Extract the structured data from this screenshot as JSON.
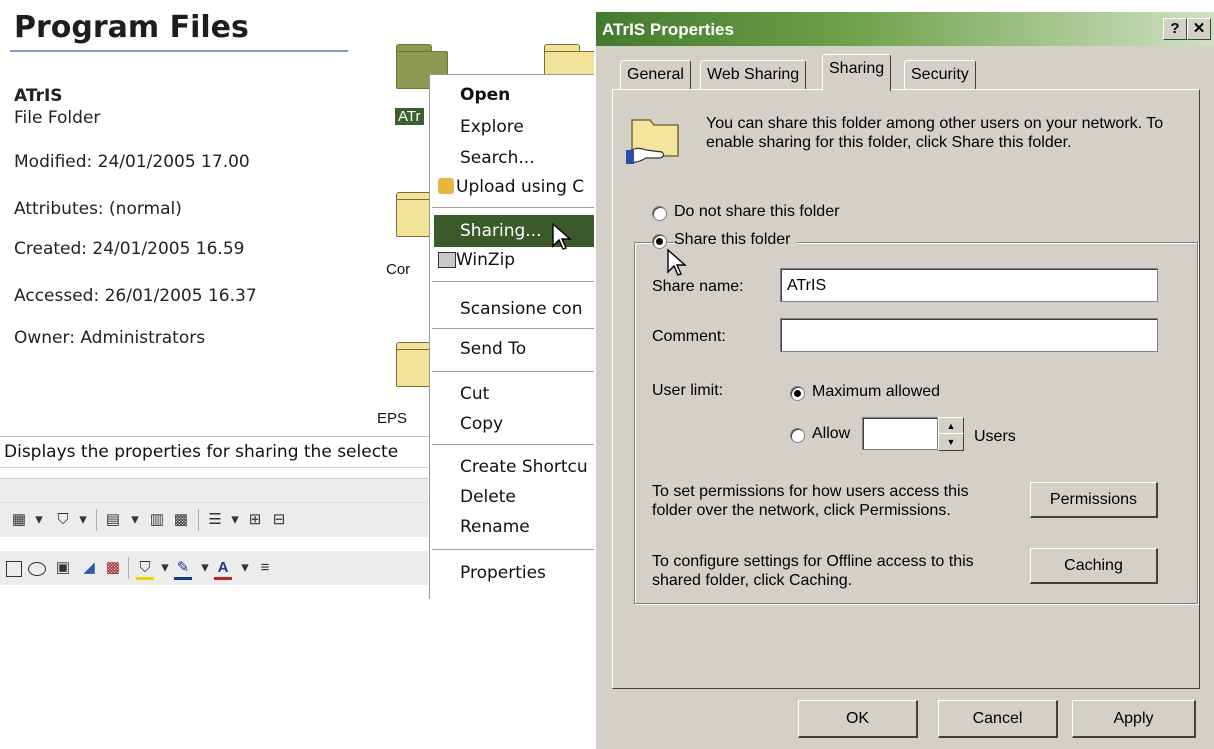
{
  "explorer": {
    "title": "Program Files",
    "selected_name": "ATrIS",
    "selected_type": "File Folder",
    "modified": "Modified: 24/01/2005 17.00",
    "attributes": "Attributes: (normal)",
    "created": "Created: 24/01/2005 16.59",
    "accessed": "Accessed: 26/01/2005 16.37",
    "owner": "Owner: Administrators",
    "folder_labels": [
      "ATr",
      "Cor",
      "EPS"
    ],
    "status_text": "Displays the properties for sharing the selecte"
  },
  "context_menu": {
    "items": [
      "Open",
      "Explore",
      "Search...",
      "Upload using C",
      "Sharing...",
      "WinZip",
      "Scansione con",
      "Send To",
      "Cut",
      "Copy",
      "Create Shortcu",
      "Delete",
      "Rename",
      "Properties"
    ],
    "highlighted": "Sharing..."
  },
  "dialog": {
    "title": "ATrIS Properties",
    "help_button": "?",
    "close_button": "✕",
    "tabs": [
      "General",
      "Web Sharing",
      "Sharing",
      "Security"
    ],
    "active_tab": "Sharing",
    "info": "You can share this folder among other users on your network.  To enable sharing for this folder, click Share this folder.",
    "radio_not_share": "Do not share this folder",
    "radio_share": "Share this folder",
    "share_name_label": "Share name:",
    "share_name_value": "ATrIS",
    "comment_label": "Comment:",
    "comment_value": "",
    "user_limit_label": "User limit:",
    "radio_max": "Maximum allowed",
    "radio_allow": "Allow",
    "allow_value": "",
    "users_label": "Users",
    "permissions_text": "To set permissions for how users access this folder over the network, click Permissions.",
    "permissions_button": "Permissions",
    "caching_text": "To configure settings for Offline access to this shared folder, click Caching.",
    "caching_button": "Caching",
    "ok_button": "OK",
    "cancel_button": "Cancel",
    "apply_button": "Apply"
  },
  "colors": {
    "titlebar": "#427a2e",
    "menu_highlight": "#3b5a2a",
    "dialog_face": "#d4d0c8"
  }
}
